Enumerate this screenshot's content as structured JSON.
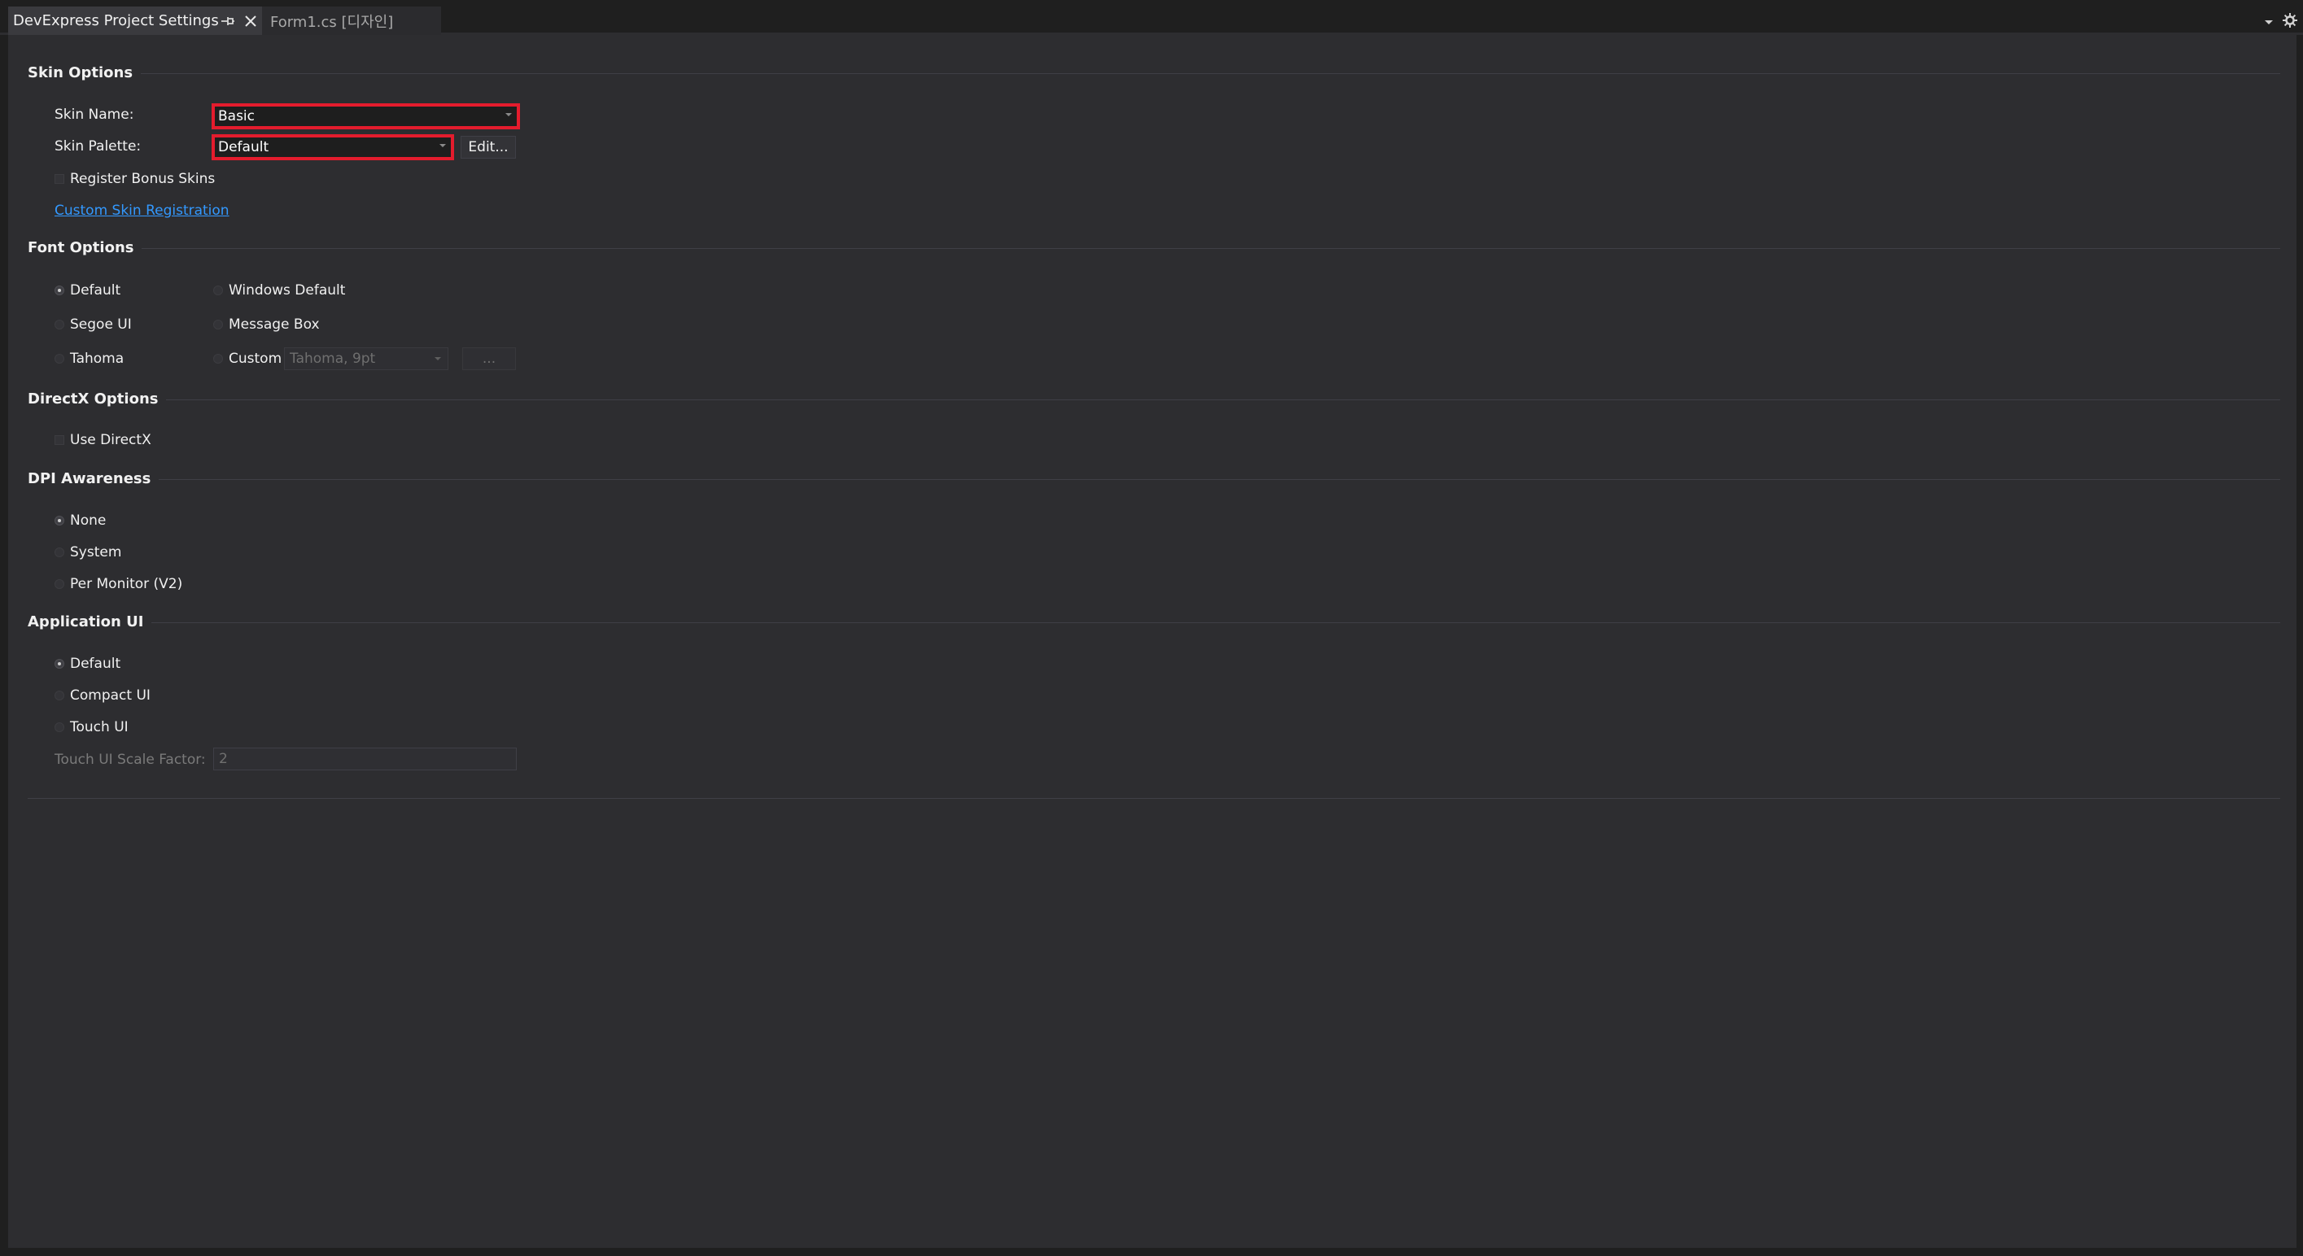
{
  "tabs": {
    "active_label": "DevExpress Project Settings",
    "inactive_label": "Form1.cs [디자인]"
  },
  "skin_options": {
    "title": "Skin Options",
    "skin_name_label": "Skin Name:",
    "skin_name_value": "Basic",
    "skin_palette_label": "Skin Palette:",
    "skin_palette_value": "Default",
    "edit_button": "Edit...",
    "register_bonus_skins": "Register Bonus Skins",
    "custom_skin_link": "Custom Skin Registration"
  },
  "font_options": {
    "title": "Font Options",
    "default": "Default",
    "windows_default": "Windows Default",
    "segoe_ui": "Segoe UI",
    "message_box": "Message Box",
    "tahoma": "Tahoma",
    "custom": "Custom",
    "custom_font_value": "Tahoma, 9pt",
    "browse_button": "..."
  },
  "directx_options": {
    "title": "DirectX Options",
    "use_directx": "Use DirectX"
  },
  "dpi_awareness": {
    "title": "DPI Awareness",
    "none": "None",
    "system": "System",
    "per_monitor": "Per Monitor (V2)"
  },
  "application_ui": {
    "title": "Application UI",
    "default": "Default",
    "compact": "Compact UI",
    "touch": "Touch UI",
    "scale_label": "Touch UI Scale Factor:",
    "scale_value": "2"
  },
  "icons": {
    "pin": "pin-icon",
    "close": "close-icon",
    "dropdown": "chevron-down-icon",
    "settings": "gear-icon"
  },
  "colors": {
    "highlight_border": "#e41c2d",
    "link": "#3399ff",
    "panel_background": "#2d2d30"
  }
}
